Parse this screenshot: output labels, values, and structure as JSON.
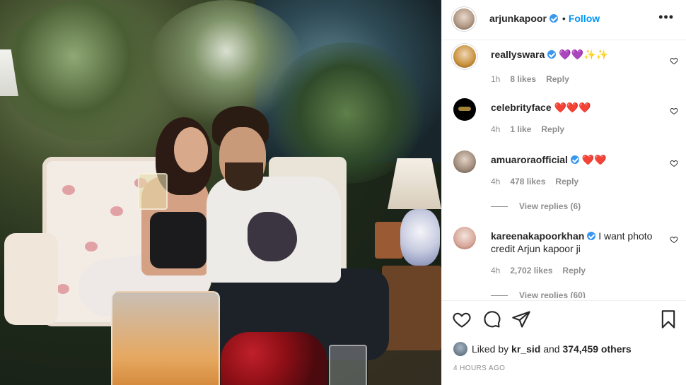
{
  "post": {
    "username": "arjunkapoor",
    "follow_label": "Follow",
    "separator": "•",
    "more_icon": "more-horizontal-icon"
  },
  "comments": [
    {
      "username": "reallyswara",
      "verified": true,
      "emoji": "💜💜✨✨",
      "time": "1h",
      "likes": "8 likes",
      "reply": "Reply"
    },
    {
      "username": "celebrityface",
      "verified": false,
      "emoji": "❤️❤️❤️",
      "time": "4h",
      "likes": "1 like",
      "reply": "Reply"
    },
    {
      "username": "amuaroraofficial",
      "verified": true,
      "emoji": "❤️❤️",
      "time": "4h",
      "likes": "478 likes",
      "reply": "Reply",
      "view_replies": "View replies (6)"
    },
    {
      "username": "kareenakapoorkhan",
      "verified": true,
      "text": "I want photo credit Arjun kapoor ji",
      "time": "4h",
      "likes": "2,702 likes",
      "reply": "Reply",
      "view_replies": "View replies (60)"
    }
  ],
  "actions": {
    "like_icon": "heart-icon",
    "comment_icon": "comment-icon",
    "share_icon": "paper-plane-icon",
    "save_icon": "bookmark-icon"
  },
  "liked_by": {
    "prefix": "Liked by",
    "user": "kr_sid",
    "middle": "and",
    "others": "374,459 others"
  },
  "timestamp": "4 HOURS AGO",
  "colors": {
    "link_blue": "#0095f6",
    "verified_blue": "#3897f0",
    "meta_gray": "#8e8e8e",
    "text": "#262626",
    "border": "#efefef"
  }
}
